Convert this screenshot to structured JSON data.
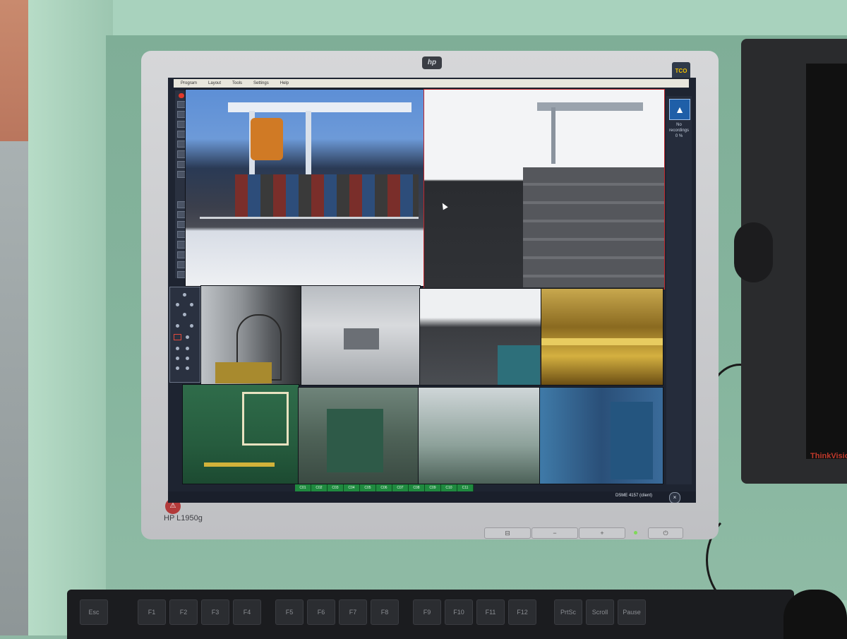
{
  "monitor": {
    "brand_logo": "hp",
    "model": "HP L1950g",
    "sticker": "TCO 03",
    "buttons": [
      "",
      "",
      "",
      ""
    ],
    "power_led_color": "#7ed957"
  },
  "side_monitor": {
    "brand": "ThinkVision"
  },
  "app": {
    "menu": [
      "Program",
      "Layout",
      "Tools",
      "Settings",
      "Help"
    ],
    "record_icon": "record-icon",
    "right_panel": {
      "line1": "No",
      "line2": "recordings",
      "line3": "0 %"
    },
    "status": "DSME 4157 (client)",
    "close_symbol": "×",
    "camera_tabs": [
      "C01",
      "C02",
      "C03",
      "C04",
      "C05",
      "C06",
      "C07",
      "C08",
      "C09",
      "C10",
      "C11"
    ],
    "accent": "#c0262c",
    "tab_color": "#1f8a3f"
  },
  "keyboard": {
    "keys": [
      "Esc",
      "F1",
      "F2",
      "F3",
      "F4",
      "F5",
      "F6",
      "F7",
      "F8",
      "F9",
      "F10",
      "F11",
      "F12",
      "PrtSc",
      "Scroll",
      "Pause"
    ]
  }
}
